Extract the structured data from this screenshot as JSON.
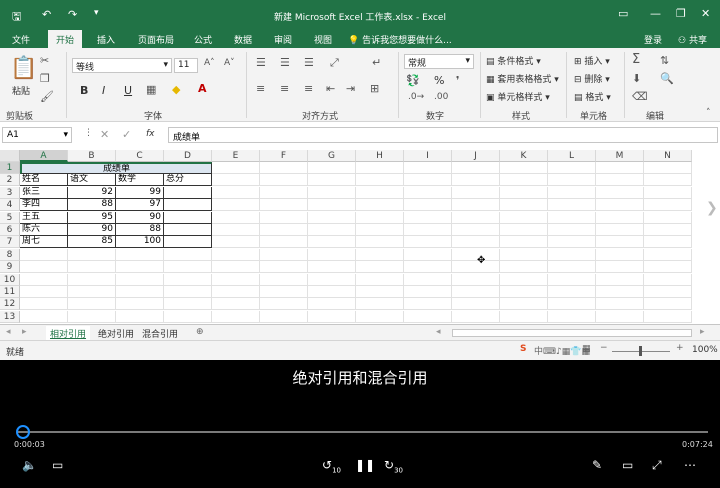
{
  "window": {
    "title": "新建 Microsoft Excel 工作表.xlsx - Excel",
    "controls": [
      "▭",
      "—",
      "❐",
      "✕"
    ]
  },
  "ribbon_tabs": [
    "文件",
    "开始",
    "插入",
    "页面布局",
    "公式",
    "数据",
    "审阅",
    "视图"
  ],
  "tell_me": "告诉我您想要做什么...",
  "account": {
    "login": "登录",
    "share": "共享"
  },
  "ribbon": {
    "clipboard": {
      "paste": "粘贴",
      "label": "剪贴板"
    },
    "font": {
      "name": "等线",
      "size": "11",
      "bold": "B",
      "italic": "I",
      "underline": "U",
      "label": "字体"
    },
    "align": {
      "label": "对齐方式"
    },
    "number": {
      "format": "常规",
      "percent": "%",
      "label": "数字"
    },
    "styles": {
      "cond": "条件格式",
      "table": "套用表格格式",
      "cell": "单元格样式",
      "label": "样式"
    },
    "cells": {
      "insert": "插入",
      "delete": "删除",
      "format": "格式",
      "label": "单元格"
    },
    "edit": {
      "label": "编辑"
    }
  },
  "formula_bar": {
    "name_box": "A1",
    "fx": "fx",
    "value": "成绩单"
  },
  "columns": [
    "A",
    "B",
    "C",
    "D",
    "E",
    "F",
    "G",
    "H",
    "I",
    "J",
    "K",
    "L",
    "M",
    "N"
  ],
  "rows": [
    "1",
    "2",
    "3",
    "4",
    "5",
    "6",
    "7",
    "8",
    "9",
    "10",
    "11",
    "12",
    "13"
  ],
  "table": {
    "title": "成绩单",
    "headers": [
      "姓名",
      "语文",
      "数学",
      "总分"
    ],
    "data": [
      [
        "张三",
        "92",
        "99",
        ""
      ],
      [
        "李四",
        "88",
        "97",
        ""
      ],
      [
        "王五",
        "95",
        "90",
        ""
      ],
      [
        "陈六",
        "90",
        "88",
        ""
      ],
      [
        "周七",
        "85",
        "100",
        ""
      ]
    ]
  },
  "sheets": [
    "相对引用",
    "绝对引用",
    "混合引用"
  ],
  "status": {
    "ready": "就绪",
    "zoom": "100%"
  },
  "video": {
    "subtitle": "绝对引用和混合引用",
    "current_time": "0:00:03",
    "total_time": "0:07:24",
    "progress": 0.007,
    "rewind": "10",
    "forward": "30"
  }
}
